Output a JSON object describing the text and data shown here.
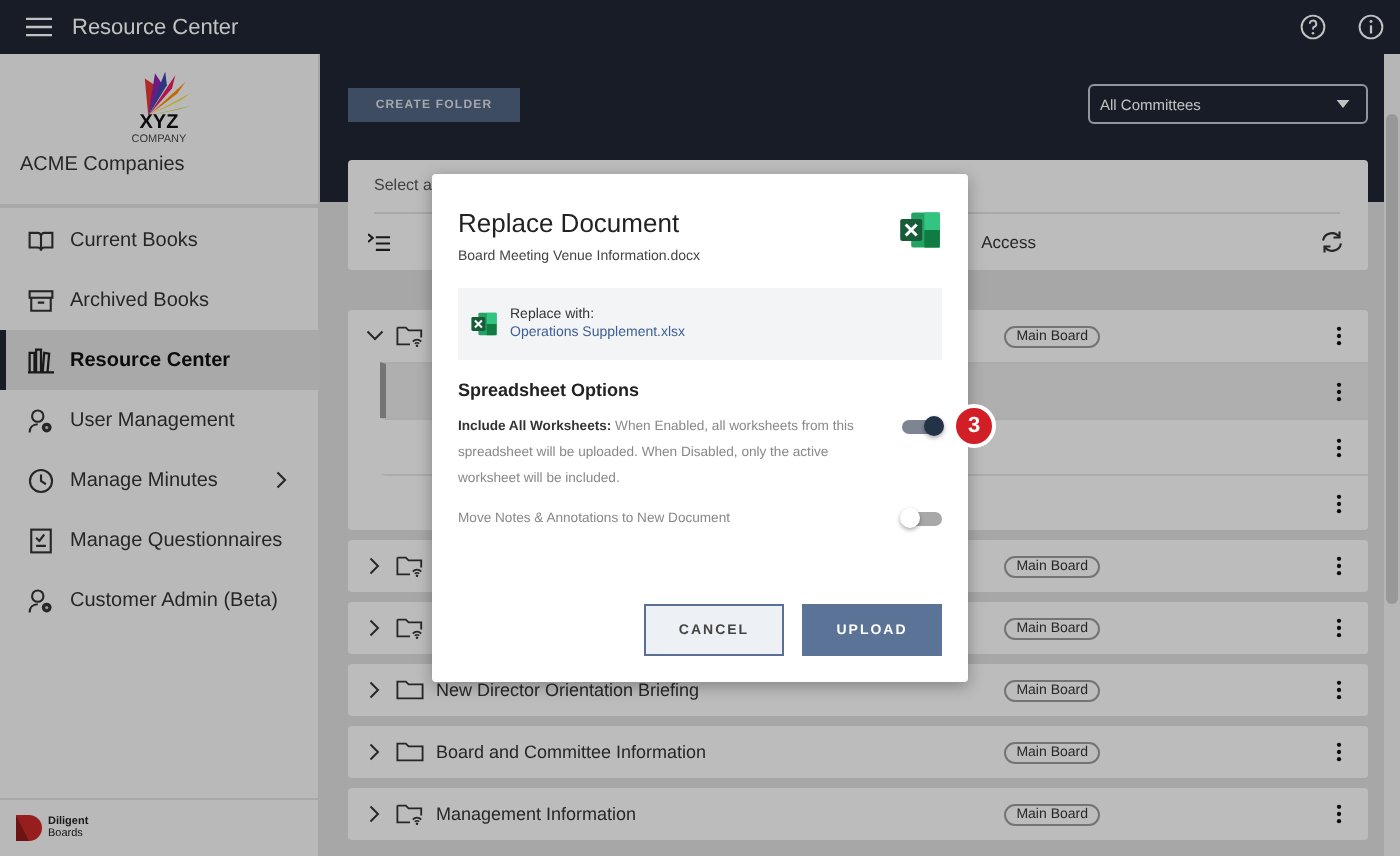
{
  "app_bar": {
    "title": "Resource Center"
  },
  "sidebar": {
    "logo": {
      "text": "XYZ",
      "subtext": "COMPANY"
    },
    "company": "ACME Companies",
    "items": [
      {
        "label": "Current Books",
        "kind": "book",
        "selected": false
      },
      {
        "label": "Archived Books",
        "kind": "archive",
        "selected": false
      },
      {
        "label": "Resource Center",
        "kind": "books",
        "selected": true
      },
      {
        "label": "User Management",
        "kind": "user",
        "selected": false
      },
      {
        "label": "Manage Minutes",
        "kind": "clock",
        "selected": false,
        "submenu": true
      },
      {
        "label": "Manage Questionnaires",
        "kind": "checklist",
        "selected": false
      },
      {
        "label": "Customer Admin (Beta)",
        "kind": "user",
        "selected": false
      }
    ],
    "footer_logo": {
      "name": "Diligent",
      "sub": "Boards"
    }
  },
  "toolbar": {
    "create_button": "CREATE FOLDER",
    "committee_select": "All Committees"
  },
  "list_header": {
    "select_text": "Select a",
    "access_label": "Access"
  },
  "folders": [
    {
      "kind": "shared",
      "expanded": true,
      "badge": "Main Board",
      "children": [
        {
          "selected": true
        },
        {
          "selected": false
        },
        {
          "selected": false
        }
      ]
    },
    {
      "kind": "shared",
      "expanded": false,
      "badge": "Main Board"
    },
    {
      "kind": "shared",
      "expanded": false,
      "badge": "Main Board"
    },
    {
      "kind": "plain",
      "expanded": false,
      "name": "New Director Orientation Briefing",
      "badge": "Main Board"
    },
    {
      "kind": "plain",
      "expanded": false,
      "name": "Board and Committee Information",
      "badge": "Main Board"
    },
    {
      "kind": "shared",
      "expanded": false,
      "name": "Management Information",
      "badge": "Main Board"
    }
  ],
  "dialog": {
    "title": "Replace Document",
    "filename": "Board Meeting Venue Information.docx",
    "replace_label": "Replace with:",
    "replace_file": "Operations Supplement.xlsx",
    "section": "Spreadsheet Options",
    "options": [
      {
        "text": "**Include All Worksheets:** When Enabled, all worksheets from this spreadsheet will be uploaded. When Disabled, only the active worksheet will be included.",
        "on": true,
        "callout": "3"
      },
      {
        "text": "Move Notes & Annotations to New Document",
        "on": false
      }
    ],
    "cancel_button": "CANCEL",
    "upload_button": "UPLOAD"
  }
}
